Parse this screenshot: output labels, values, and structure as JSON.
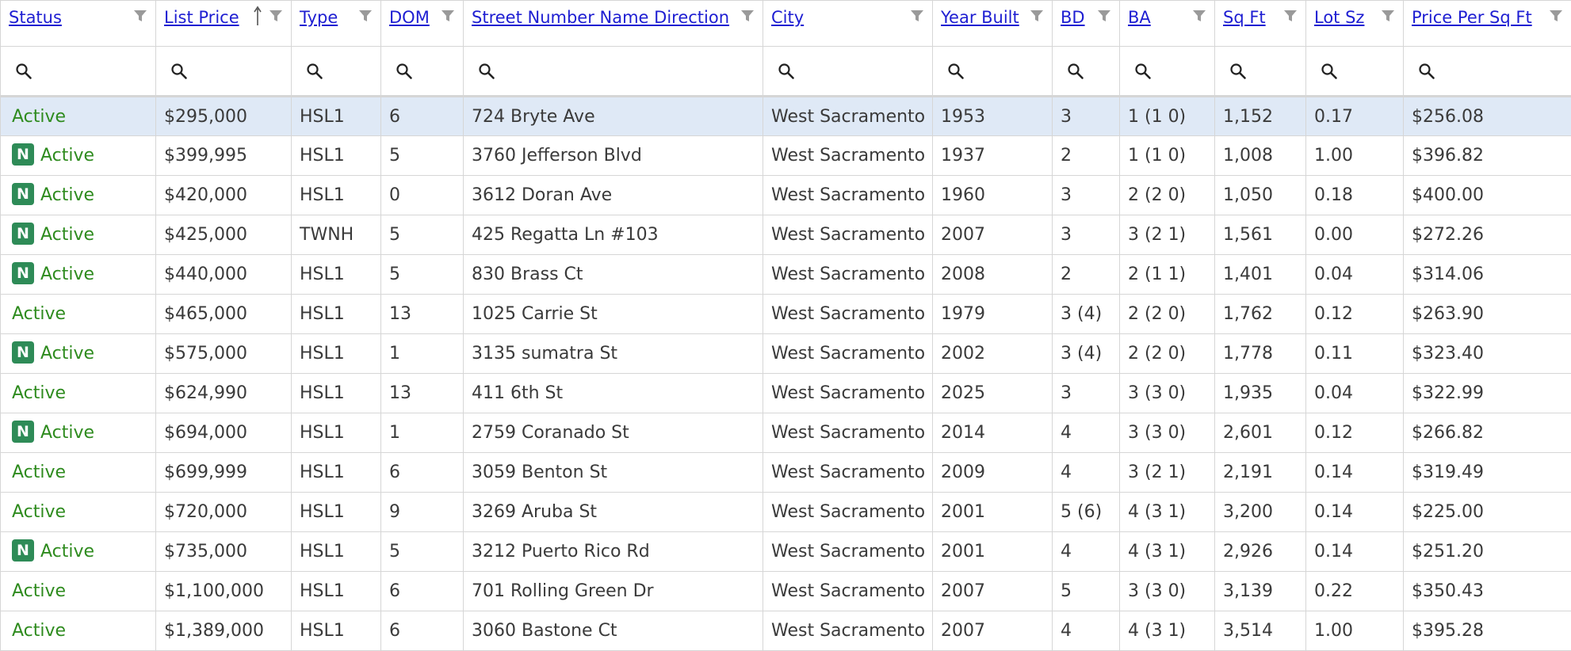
{
  "columns": [
    {
      "key": "status",
      "label": "Status"
    },
    {
      "key": "list_price",
      "label": "List Price",
      "sort": "ascending"
    },
    {
      "key": "type",
      "label": "Type"
    },
    {
      "key": "dom",
      "label": "DOM"
    },
    {
      "key": "street",
      "label": "Street Number Name Direction"
    },
    {
      "key": "city",
      "label": "City"
    },
    {
      "key": "year_built",
      "label": "Year Built"
    },
    {
      "key": "bd",
      "label": "BD"
    },
    {
      "key": "ba",
      "label": "BA"
    },
    {
      "key": "sqft",
      "label": "Sq Ft"
    },
    {
      "key": "lot_sz",
      "label": "Lot Sz"
    },
    {
      "key": "price_per_sqft",
      "label": "Price Per Sq Ft"
    }
  ],
  "badge_label": "N",
  "colors": {
    "header_link": "#1e1ed2",
    "status_active": "#2e8b1e",
    "new_badge": "#2e8b57",
    "selected_row": "#dfe9f6",
    "grid_line": "#d6d6d6"
  },
  "rows": [
    {
      "status": "Active",
      "new": false,
      "list_price": "$295,000",
      "type": "HSL1",
      "dom": "6",
      "street": "724 Bryte Ave",
      "city": "West Sacramento",
      "year_built": "1953",
      "bd": "3",
      "ba": "1 (1 0)",
      "sqft": "1,152",
      "lot_sz": "0.17",
      "price_per_sqft": "$256.08",
      "selected": true
    },
    {
      "status": "Active",
      "new": true,
      "list_price": "$399,995",
      "type": "HSL1",
      "dom": "5",
      "street": "3760 Jefferson Blvd",
      "city": "West Sacramento",
      "year_built": "1937",
      "bd": "2",
      "ba": "1 (1 0)",
      "sqft": "1,008",
      "lot_sz": "1.00",
      "price_per_sqft": "$396.82"
    },
    {
      "status": "Active",
      "new": true,
      "list_price": "$420,000",
      "type": "HSL1",
      "dom": "0",
      "street": "3612 Doran Ave",
      "city": "West Sacramento",
      "year_built": "1960",
      "bd": "3",
      "ba": "2 (2 0)",
      "sqft": "1,050",
      "lot_sz": "0.18",
      "price_per_sqft": "$400.00"
    },
    {
      "status": "Active",
      "new": true,
      "list_price": "$425,000",
      "type": "TWNH",
      "dom": "5",
      "street": "425 Regatta Ln #103",
      "city": "West Sacramento",
      "year_built": "2007",
      "bd": "3",
      "ba": "3 (2 1)",
      "sqft": "1,561",
      "lot_sz": "0.00",
      "price_per_sqft": "$272.26"
    },
    {
      "status": "Active",
      "new": true,
      "list_price": "$440,000",
      "type": "HSL1",
      "dom": "5",
      "street": "830 Brass Ct",
      "city": "West Sacramento",
      "year_built": "2008",
      "bd": "2",
      "ba": "2 (1 1)",
      "sqft": "1,401",
      "lot_sz": "0.04",
      "price_per_sqft": "$314.06"
    },
    {
      "status": "Active",
      "new": false,
      "list_price": "$465,000",
      "type": "HSL1",
      "dom": "13",
      "street": "1025 Carrie St",
      "city": "West Sacramento",
      "year_built": "1979",
      "bd": "3 (4)",
      "ba": "2 (2 0)",
      "sqft": "1,762",
      "lot_sz": "0.12",
      "price_per_sqft": "$263.90"
    },
    {
      "status": "Active",
      "new": true,
      "list_price": "$575,000",
      "type": "HSL1",
      "dom": "1",
      "street": "3135 sumatra St",
      "city": "West Sacramento",
      "year_built": "2002",
      "bd": "3 (4)",
      "ba": "2 (2 0)",
      "sqft": "1,778",
      "lot_sz": "0.11",
      "price_per_sqft": "$323.40"
    },
    {
      "status": "Active",
      "new": false,
      "list_price": "$624,990",
      "type": "HSL1",
      "dom": "13",
      "street": "411 6th St",
      "city": "West Sacramento",
      "year_built": "2025",
      "bd": "3",
      "ba": "3 (3 0)",
      "sqft": "1,935",
      "lot_sz": "0.04",
      "price_per_sqft": "$322.99"
    },
    {
      "status": "Active",
      "new": true,
      "list_price": "$694,000",
      "type": "HSL1",
      "dom": "1",
      "street": "2759 Coranado St",
      "city": "West Sacramento",
      "year_built": "2014",
      "bd": "4",
      "ba": "3 (3 0)",
      "sqft": "2,601",
      "lot_sz": "0.12",
      "price_per_sqft": "$266.82"
    },
    {
      "status": "Active",
      "new": false,
      "list_price": "$699,999",
      "type": "HSL1",
      "dom": "6",
      "street": "3059 Benton St",
      "city": "West Sacramento",
      "year_built": "2009",
      "bd": "4",
      "ba": "3 (2 1)",
      "sqft": "2,191",
      "lot_sz": "0.14",
      "price_per_sqft": "$319.49"
    },
    {
      "status": "Active",
      "new": false,
      "list_price": "$720,000",
      "type": "HSL1",
      "dom": "9",
      "street": "3269 Aruba St",
      "city": "West Sacramento",
      "year_built": "2001",
      "bd": "5 (6)",
      "ba": "4 (3 1)",
      "sqft": "3,200",
      "lot_sz": "0.14",
      "price_per_sqft": "$225.00"
    },
    {
      "status": "Active",
      "new": true,
      "list_price": "$735,000",
      "type": "HSL1",
      "dom": "5",
      "street": "3212 Puerto Rico Rd",
      "city": "West Sacramento",
      "year_built": "2001",
      "bd": "4",
      "ba": "4 (3 1)",
      "sqft": "2,926",
      "lot_sz": "0.14",
      "price_per_sqft": "$251.20"
    },
    {
      "status": "Active",
      "new": false,
      "list_price": "$1,100,000",
      "type": "HSL1",
      "dom": "6",
      "street": "701 Rolling Green Dr",
      "city": "West Sacramento",
      "year_built": "2007",
      "bd": "5",
      "ba": "3 (3 0)",
      "sqft": "3,139",
      "lot_sz": "0.22",
      "price_per_sqft": "$350.43"
    },
    {
      "status": "Active",
      "new": false,
      "list_price": "$1,389,000",
      "type": "HSL1",
      "dom": "6",
      "street": "3060 Bastone Ct",
      "city": "West Sacramento",
      "year_built": "2007",
      "bd": "4",
      "ba": "4 (3 1)",
      "sqft": "3,514",
      "lot_sz": "1.00",
      "price_per_sqft": "$395.28"
    }
  ]
}
